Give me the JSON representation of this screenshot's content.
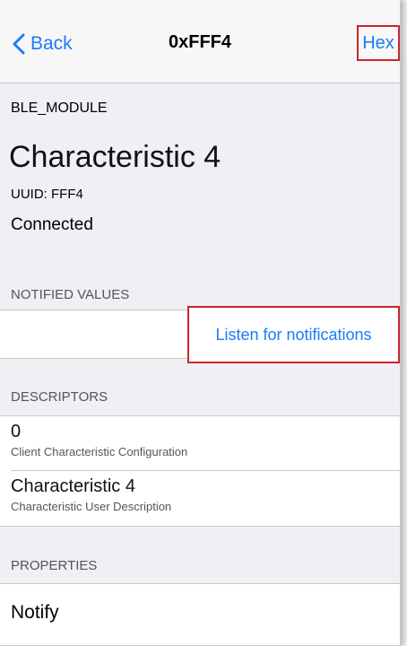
{
  "navbar": {
    "back_label": "Back",
    "title": "0xFFF4",
    "hex_label": "Hex"
  },
  "device": {
    "name": "BLE_MODULE"
  },
  "characteristic": {
    "title": "Characteristic 4",
    "uuid": "UUID: FFF4",
    "status": "Connected"
  },
  "notified": {
    "header": "NOTIFIED VALUES",
    "listen_label": "Listen for notifications"
  },
  "descriptors": {
    "header": "DESCRIPTORS",
    "items": [
      {
        "value": "0",
        "description": "Client Characteristic Configuration"
      },
      {
        "value": "Characteristic 4",
        "description": "Characteristic User Description"
      }
    ]
  },
  "properties": {
    "header": "PROPERTIES",
    "items": [
      "Notify"
    ]
  },
  "colors": {
    "accent": "#1a7cf6",
    "highlight": "#c9252c",
    "background": "#efeff4"
  }
}
